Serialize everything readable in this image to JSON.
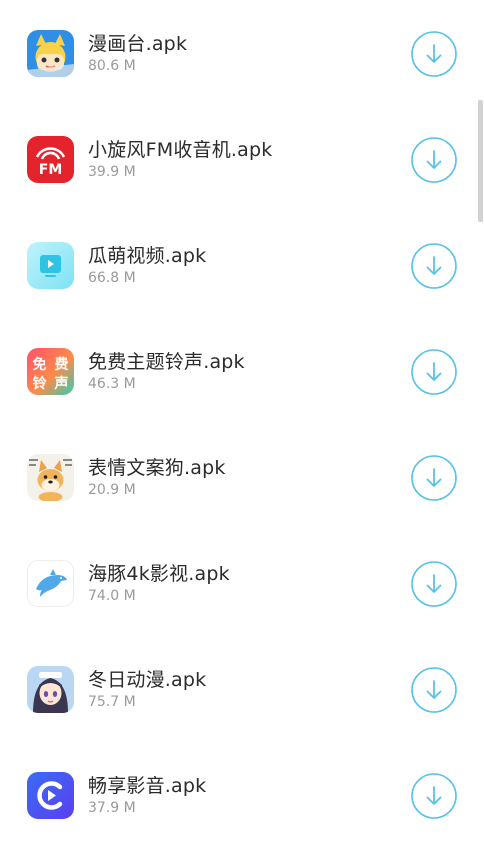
{
  "apps": [
    {
      "name": "漫画台.apk",
      "size": "80.6 M",
      "icon": "anime-character-icon"
    },
    {
      "name": "小旋风FM收音机.apk",
      "size": "39.9 M",
      "icon": "fm-radio-icon"
    },
    {
      "name": "瓜萌视频.apk",
      "size": "66.8 M",
      "icon": "video-play-icon"
    },
    {
      "name": "免费主题铃声.apk",
      "size": "46.3 M",
      "icon": "ringtone-icon",
      "icon_text": [
        "免",
        "费",
        "铃",
        "声"
      ]
    },
    {
      "name": "表情文案狗.apk",
      "size": "20.9 M",
      "icon": "doge-meme-icon"
    },
    {
      "name": "海豚4k影视.apk",
      "size": "74.0 M",
      "icon": "dolphin-icon"
    },
    {
      "name": "冬日动漫.apk",
      "size": "75.7 M",
      "icon": "anime-girl-icon"
    },
    {
      "name": "畅享影音.apk",
      "size": "37.9 M",
      "icon": "media-player-icon"
    }
  ],
  "download_icon": "download-arrow-icon",
  "colors": {
    "accent": "#55c2e8",
    "title": "#2b2b2b",
    "subtitle": "#9a9a9a"
  }
}
